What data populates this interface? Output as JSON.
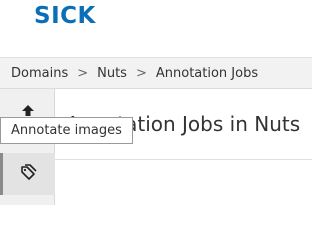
{
  "header": {
    "logo_text": "SICK"
  },
  "breadcrumb": {
    "items": [
      "Domains",
      "Nuts",
      "Annotation Jobs"
    ],
    "separator": ">"
  },
  "sidebar": {
    "items": [
      {
        "icon": "upload-icon"
      },
      {
        "icon": "tag-icon",
        "active": true
      }
    ]
  },
  "tooltip": {
    "text": "Annotate images"
  },
  "main": {
    "title": "Annotation Jobs in Nuts"
  },
  "colors": {
    "brand": "#0a6fb7",
    "breadcrumb_bg": "#f2f2f2",
    "sidebar_bg": "#f0f0f0"
  }
}
